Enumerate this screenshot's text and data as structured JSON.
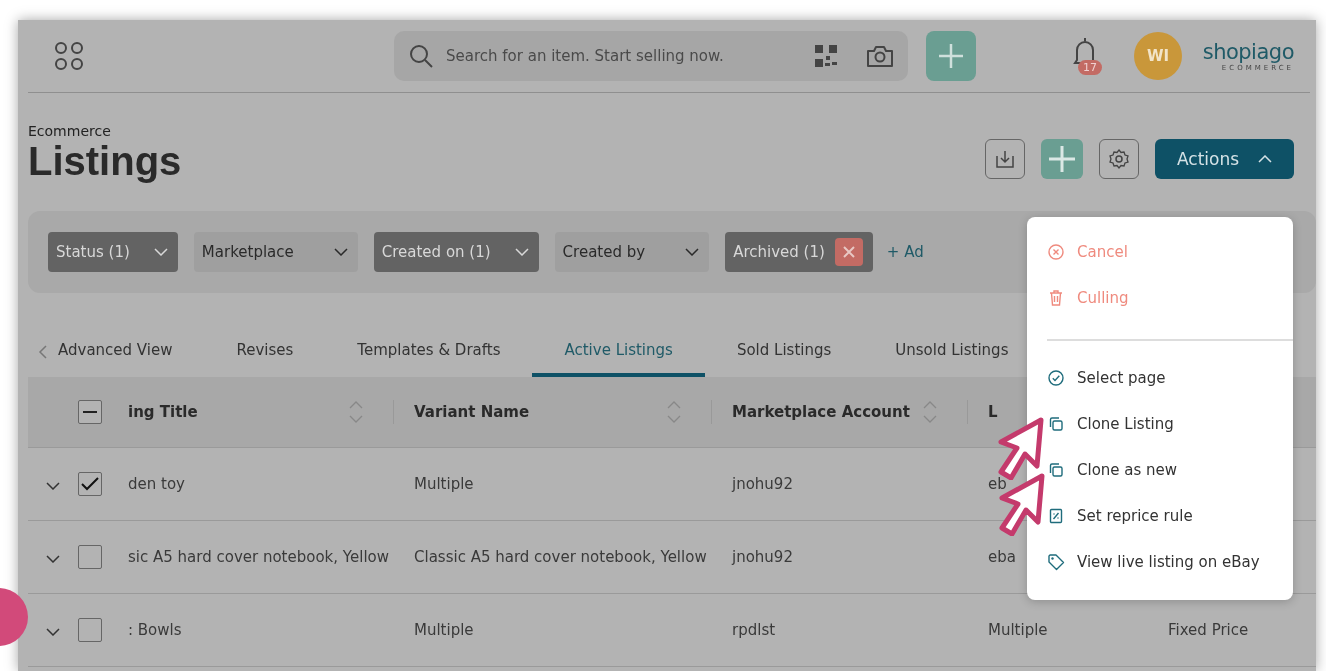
{
  "top_bar": {
    "search": {
      "placeholder": "Search for an item. Start selling now."
    },
    "notifications": {
      "count": "17"
    },
    "avatar": {
      "initials": "WI"
    },
    "logo": {
      "name": "shopiago",
      "tagline": "ECOMMERCE"
    }
  },
  "header": {
    "breadcrumb": "Ecommerce",
    "title": "Listings",
    "actions_button": "Actions"
  },
  "filters": [
    {
      "label": "Status (1)",
      "active": true,
      "removable": false
    },
    {
      "label": "Marketplace",
      "active": false,
      "removable": false
    },
    {
      "label": "Created on (1)",
      "active": true,
      "removable": false
    },
    {
      "label": "Created by",
      "active": false,
      "removable": false
    },
    {
      "label": "Archived (1)",
      "active": true,
      "removable": true
    }
  ],
  "add_filter": "+ Ad",
  "tabs": [
    {
      "label": "Advanced View",
      "selected": false
    },
    {
      "label": "Revises",
      "selected": false
    },
    {
      "label": "Templates & Drafts",
      "selected": false
    },
    {
      "label": "Active Listings",
      "selected": true
    },
    {
      "label": "Sold Listings",
      "selected": false
    },
    {
      "label": "Unsold Listings",
      "selected": false
    }
  ],
  "table": {
    "select_all_partial": true,
    "columns": [
      "ing Title",
      "Variant Name",
      "Marketplace Account",
      "L"
    ],
    "rows": [
      {
        "checked": true,
        "cells": [
          "den toy",
          "Multiple",
          "jnohu92",
          "eb"
        ]
      },
      {
        "checked": false,
        "cells": [
          "sic A5 hard cover notebook, Yellow",
          "Classic A5 hard cover notebook, Yellow",
          "jnohu92",
          "eba"
        ]
      },
      {
        "checked": false,
        "cells": [
          ": Bowls",
          "Multiple",
          "rpdlst",
          "Multiple",
          "Fixed Price"
        ]
      }
    ]
  },
  "actions_menu": [
    {
      "label": "Cancel",
      "kind": "cancel"
    },
    {
      "label": "Culling",
      "kind": "culling"
    },
    {
      "label": "Select page",
      "kind": "select"
    },
    {
      "label": "Clone Listing",
      "kind": "clone"
    },
    {
      "label": "Clone as new",
      "kind": "clone"
    },
    {
      "label": "Set reprice rule",
      "kind": "reprice"
    },
    {
      "label": "View live listing on eBay",
      "kind": "view"
    }
  ]
}
